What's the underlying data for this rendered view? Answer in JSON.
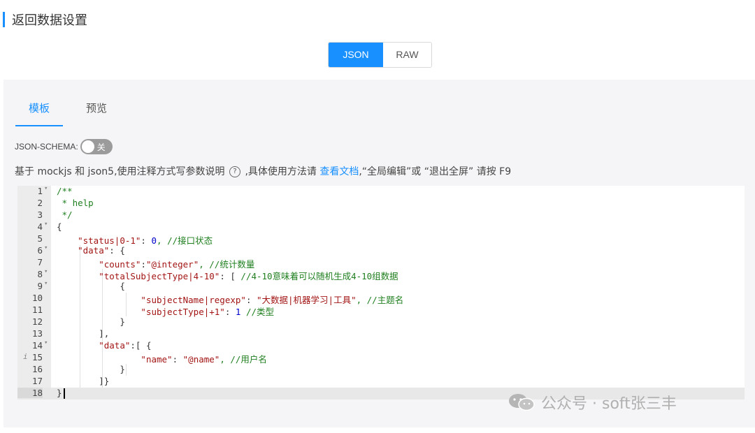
{
  "section": {
    "title": "返回数据设置"
  },
  "mode_toggle": {
    "json_label": "JSON",
    "raw_label": "RAW",
    "selected": "JSON"
  },
  "tabs": {
    "template": "模板",
    "preview": "预览",
    "active": "模板"
  },
  "schema": {
    "label": "JSON-SCHEMA:",
    "state": "关"
  },
  "help": {
    "text_before": "基于 mockjs 和 json5,使用注释方式写参数说明",
    "text_middle": ",具体使用方法请",
    "link": "查看文档",
    "text_after": ",“全局编辑”或 “退出全屏” 请按 F9"
  },
  "editor": {
    "active_line": 18,
    "lines": [
      {
        "n": "1",
        "fold": true
      },
      {
        "n": "2"
      },
      {
        "n": "3"
      },
      {
        "n": "4",
        "fold": true
      },
      {
        "n": "5"
      },
      {
        "n": "6",
        "fold": true
      },
      {
        "n": "7"
      },
      {
        "n": "8",
        "fold": true
      },
      {
        "n": "9",
        "fold": true
      },
      {
        "n": "10"
      },
      {
        "n": "11"
      },
      {
        "n": "12"
      },
      {
        "n": "13"
      },
      {
        "n": "14",
        "fold": true
      },
      {
        "n": "15",
        "info": true
      },
      {
        "n": "16"
      },
      {
        "n": "17"
      },
      {
        "n": "18"
      }
    ],
    "code": {
      "l1": "/**",
      "l2": " * help",
      "l3": " */",
      "l4": "{",
      "l5_key": "\"status|0-1\"",
      "l5_rest": ": ",
      "l5_num": "0",
      "l5_comment": ", //接口状态",
      "l6_key": "\"data\"",
      "l6_rest": ": {",
      "l7_key": "\"counts\"",
      "l7_colon": ":",
      "l7_val": "\"@integer\"",
      "l7_comment": ", //统计数量",
      "l8_key": "\"totalSubjectType|4-10\"",
      "l8_rest": ": [ ",
      "l8_comment": "//4-10意味着可以随机生成4-10组数据",
      "l9": "{",
      "l10_key": "\"subjectName|regexp\"",
      "l10_colon": ": ",
      "l10_val": "\"大数据|机器学习|工具\"",
      "l10_comment": ", //主题名",
      "l11_key": "\"subjectType|+1\"",
      "l11_colon": ": ",
      "l11_num": "1",
      "l11_comment": " //类型",
      "l12": "}",
      "l13": "],",
      "l14_key": "\"data\"",
      "l14_rest": ":[ {",
      "l15_key": "\"name\"",
      "l15_colon": ": ",
      "l15_val": "\"@name\"",
      "l15_comment": ", //用户名",
      "l16": "}",
      "l17": "]}",
      "l18": "}"
    }
  },
  "watermark": {
    "text": "公众号 · soft张三丰"
  }
}
